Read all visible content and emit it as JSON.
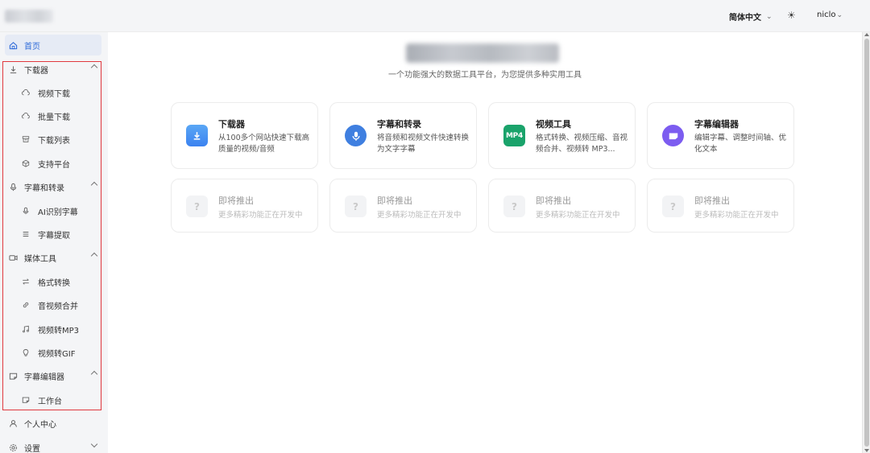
{
  "header": {
    "language": "简体中文",
    "theme_icon": "sun-icon",
    "username": "niclo"
  },
  "sidebar": {
    "home": "首页",
    "groups": [
      {
        "label": "下载器",
        "icon": "download-icon",
        "expanded": true,
        "items": [
          {
            "label": "视频下载",
            "icon": "cloud-icon"
          },
          {
            "label": "批量下载",
            "icon": "cloud-icon"
          },
          {
            "label": "下载列表",
            "icon": "archive-icon"
          },
          {
            "label": "支持平台",
            "icon": "cube-icon"
          }
        ]
      },
      {
        "label": "字幕和转录",
        "icon": "mic-icon",
        "expanded": true,
        "items": [
          {
            "label": "AI识别字幕",
            "icon": "mic-icon"
          },
          {
            "label": "字幕提取",
            "icon": "list-icon"
          }
        ]
      },
      {
        "label": "媒体工具",
        "icon": "video-icon",
        "expanded": true,
        "items": [
          {
            "label": "格式转换",
            "icon": "swap-icon"
          },
          {
            "label": "音视频合并",
            "icon": "link-icon"
          },
          {
            "label": "视频转MP3",
            "icon": "music-icon"
          },
          {
            "label": "视频转GIF",
            "icon": "bulb-icon"
          }
        ]
      },
      {
        "label": "字幕编辑器",
        "icon": "caption-icon",
        "expanded": true,
        "items": [
          {
            "label": "工作台",
            "icon": "caption-icon"
          }
        ]
      }
    ],
    "profile": "个人中心",
    "settings": "设置"
  },
  "main": {
    "subtitle": "一个功能强大的数据工具平台，为您提供多种实用工具",
    "tools": [
      {
        "title": "下载器",
        "desc": "从100多个网站快速下载高质量的视频/音频",
        "icon": "download-icon"
      },
      {
        "title": "字幕和转录",
        "desc": "将音频和视频文件快速转换为文字字幕",
        "icon": "mic-icon"
      },
      {
        "title": "视频工具",
        "desc": "格式转换、视频压缩、音视频合并、视频转 MP3...",
        "icon": "mp4-icon",
        "icon_text": "MP4"
      },
      {
        "title": "字幕编辑器",
        "desc": "编辑字幕、调整时间轴、优化文本",
        "icon": "caption-icon"
      }
    ],
    "coming_soon": [
      {
        "title": "即将推出",
        "desc": "更多精彩功能正在开发中",
        "icon_text": "?"
      },
      {
        "title": "即将推出",
        "desc": "更多精彩功能正在开发中",
        "icon_text": "?"
      },
      {
        "title": "即将推出",
        "desc": "更多精彩功能正在开发中",
        "icon_text": "?"
      },
      {
        "title": "即将推出",
        "desc": "更多精彩功能正在开发中",
        "icon_text": "?"
      }
    ]
  },
  "colors": {
    "accent": "#2f6bd9",
    "highlight_border": "#e0383e"
  }
}
